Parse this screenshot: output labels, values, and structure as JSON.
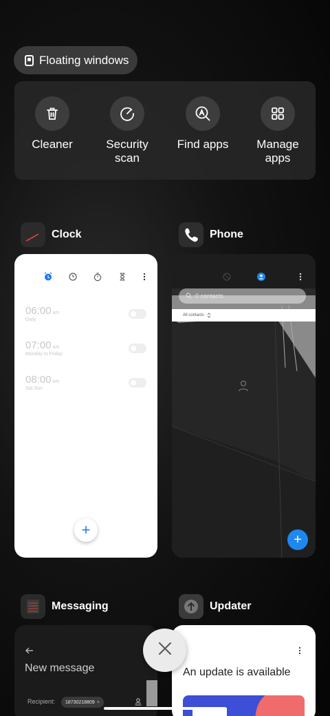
{
  "floating_windows": {
    "label": "Floating windows"
  },
  "tools": [
    {
      "label": "Cleaner",
      "icon": "trash-icon"
    },
    {
      "label": "Security scan",
      "icon": "security-scan-icon"
    },
    {
      "label": "Find apps",
      "icon": "find-apps-icon"
    },
    {
      "label": "Manage apps",
      "icon": "grid-icon"
    }
  ],
  "apps": {
    "clock": {
      "name": "Clock",
      "alarms": [
        {
          "time": "06:00",
          "ampm": "am",
          "repeat": "Daily"
        },
        {
          "time": "07:00",
          "ampm": "am",
          "repeat": "Monday to Friday"
        },
        {
          "time": "08:00",
          "ampm": "am",
          "repeat": "Sat Sun"
        }
      ],
      "accent": "#1e7cf0"
    },
    "phone": {
      "name": "Phone",
      "search_placeholder": "0 contacts",
      "filter_label": "All contacts",
      "accent": "#1e88f0"
    },
    "messaging": {
      "name": "Messaging",
      "title": "New message",
      "recipient_label": "Recipient:",
      "recipient_value": "18730218809"
    },
    "updater": {
      "name": "Updater",
      "message": "An update is available"
    }
  }
}
